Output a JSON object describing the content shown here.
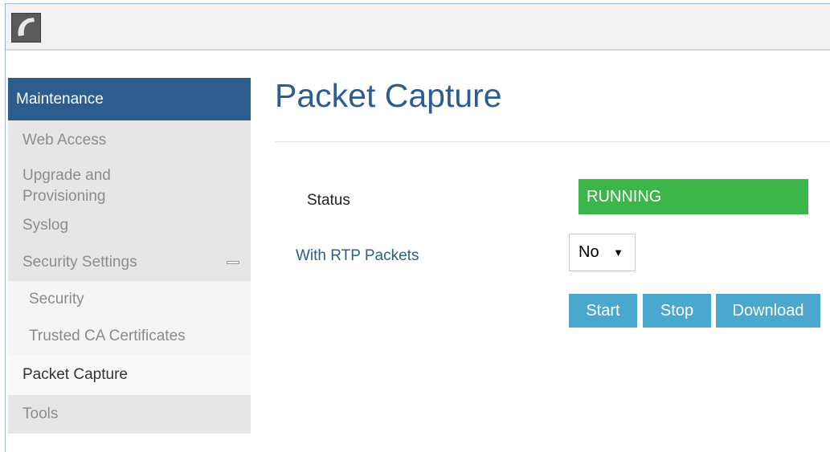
{
  "header": {
    "logo_icon": "phone-handset-icon"
  },
  "sidebar": {
    "title": "Maintenance",
    "items": [
      {
        "label": "Web Access"
      },
      {
        "label": "Upgrade and Provisioning"
      },
      {
        "label": "Syslog"
      },
      {
        "label": "Security Settings"
      },
      {
        "label": "Security"
      },
      {
        "label": "Trusted CA Certificates"
      },
      {
        "label": "Packet Capture"
      },
      {
        "label": "Tools"
      }
    ]
  },
  "main": {
    "title": "Packet Capture",
    "status_label": "Status",
    "status_value": "RUNNING",
    "rtp_label": "With RTP Packets",
    "rtp_value": "No",
    "buttons": {
      "start": "Start",
      "stop": "Stop",
      "download": "Download"
    }
  },
  "colors": {
    "accent": "#2d5d8f",
    "status_running": "#3cb64a",
    "button": "#4aa7cd"
  }
}
